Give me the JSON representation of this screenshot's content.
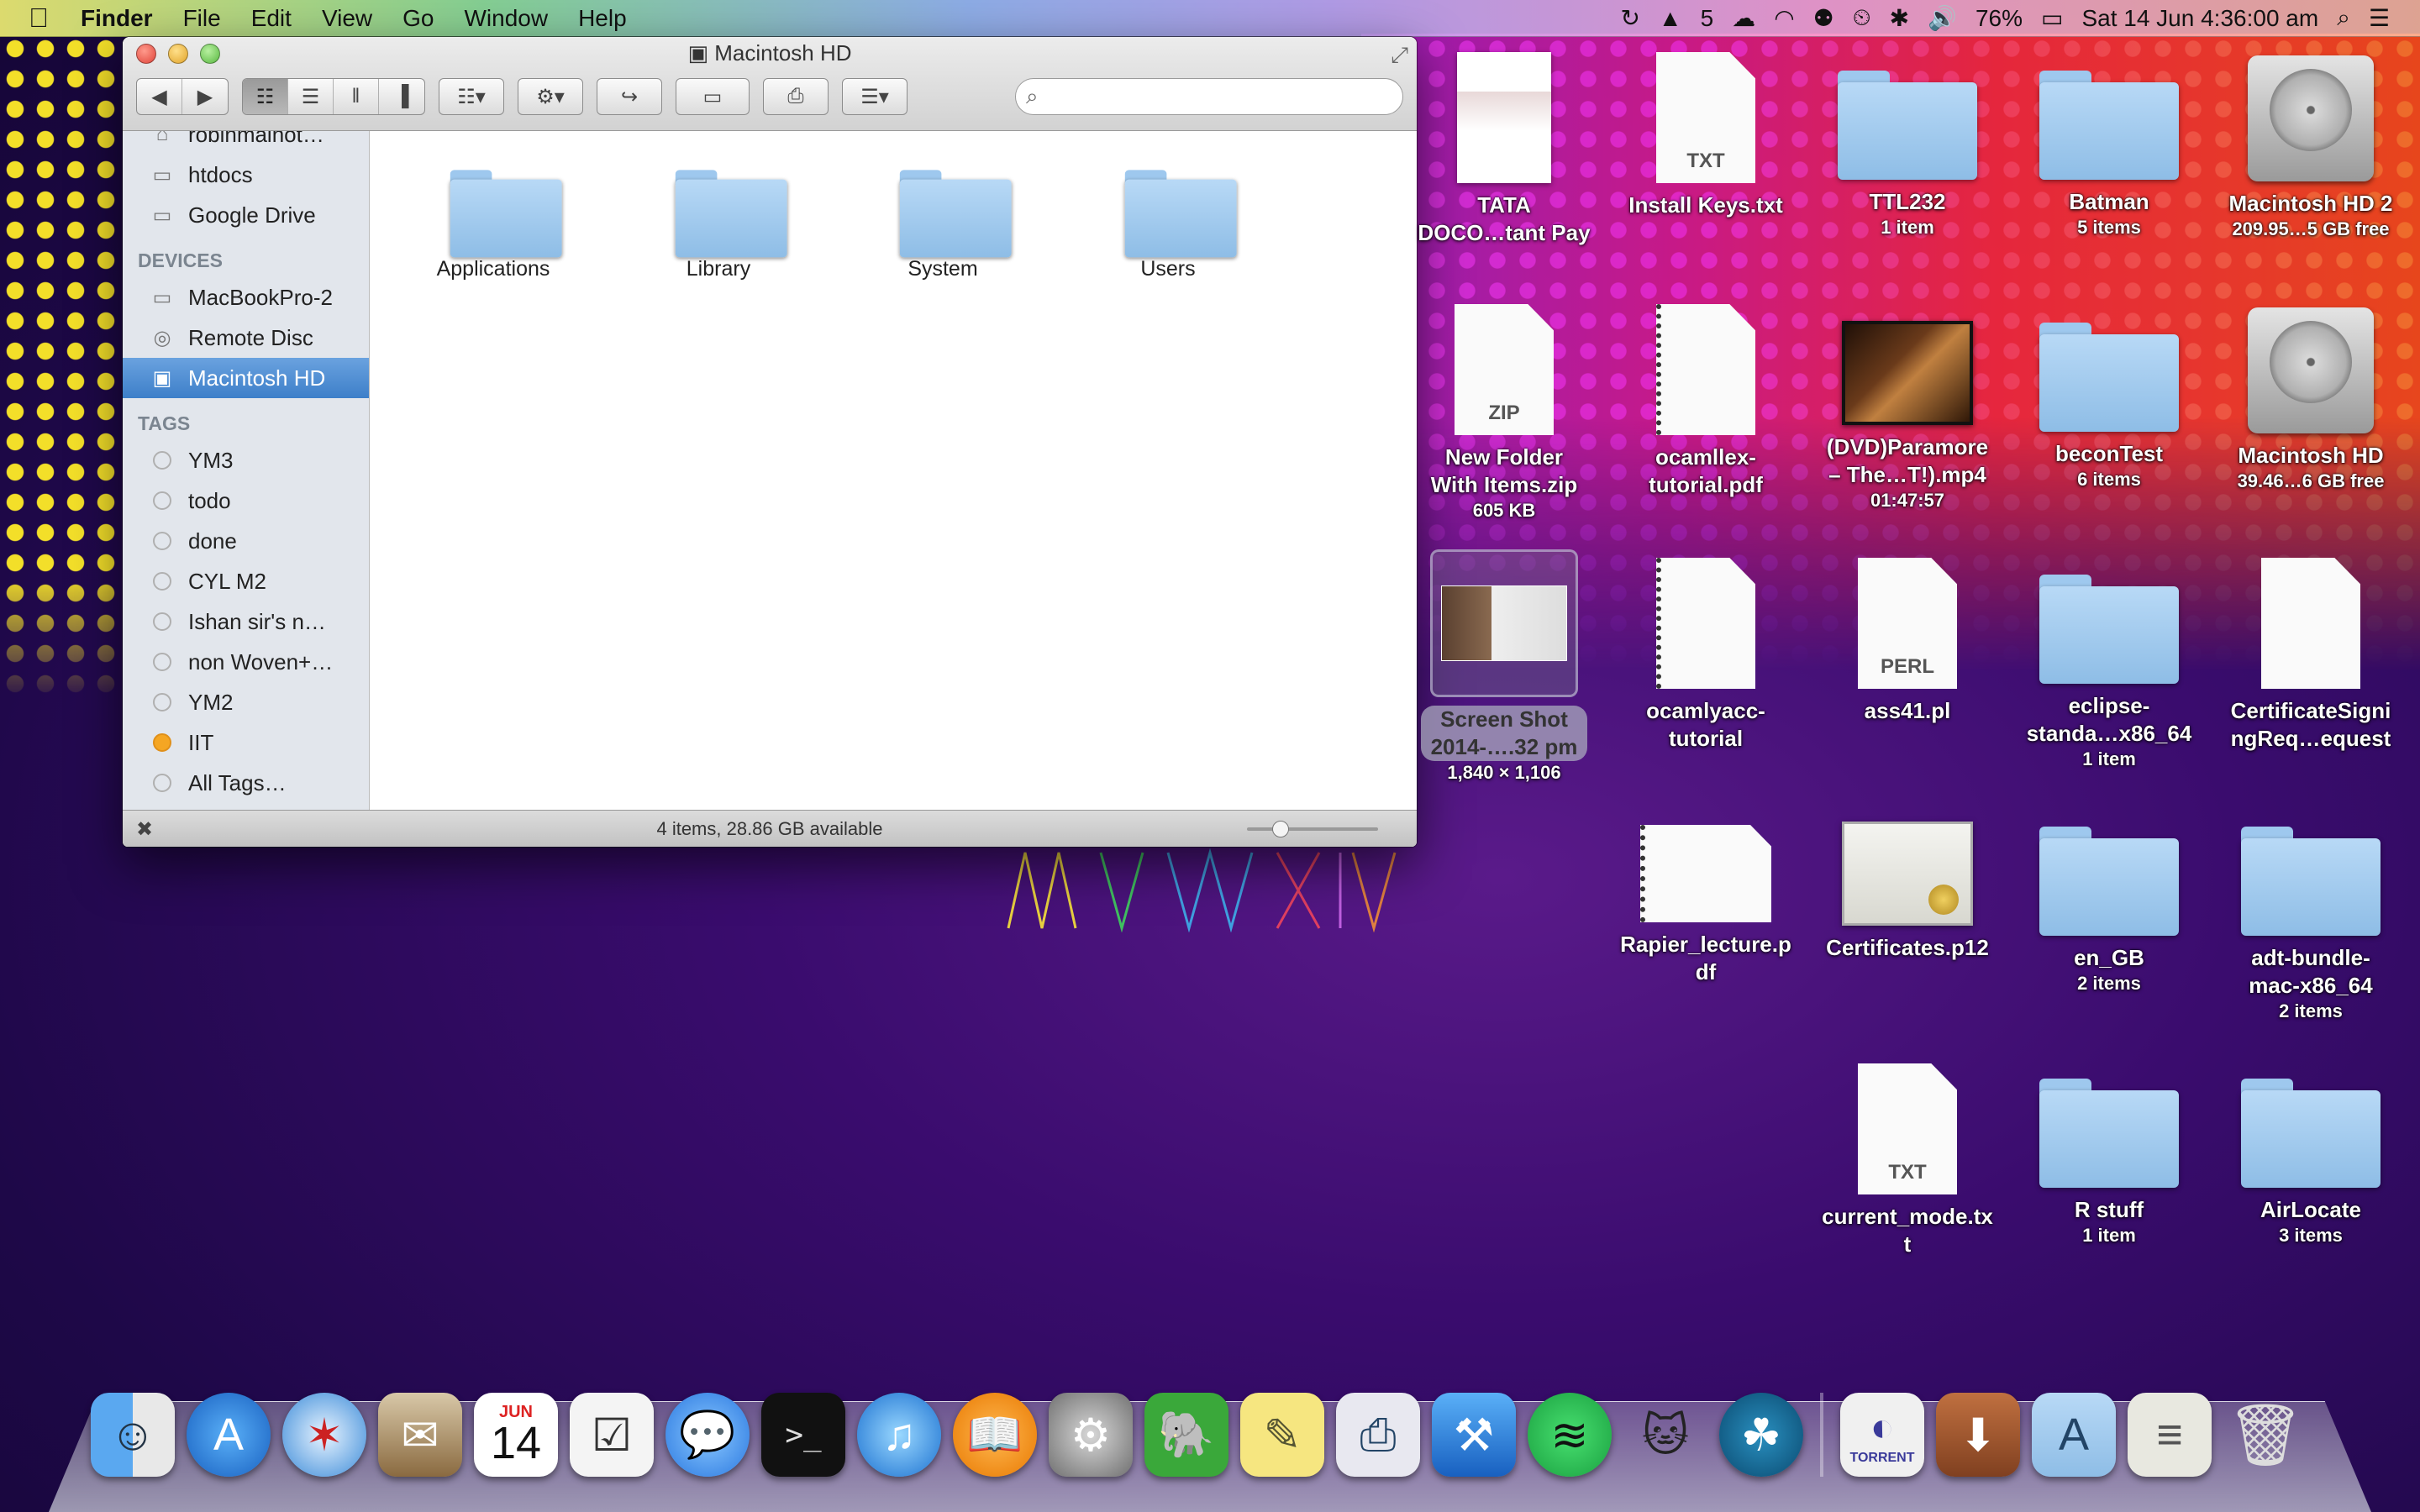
{
  "menubar": {
    "apple": "",
    "app_name": "Finder",
    "menus": [
      "File",
      "Edit",
      "View",
      "Go",
      "Window",
      "Help"
    ],
    "status": {
      "adobe_count": "5",
      "battery": "76%",
      "date_time": "Sat 14 Jun  4:36:00 am"
    }
  },
  "finder": {
    "title": "Macintosh HD",
    "sidebar": {
      "top_items": [
        "robinmainot…",
        "htdocs",
        "Google Drive"
      ],
      "devices_heading": "DEVICES",
      "devices": [
        "MacBookPro-2",
        "Remote Disc",
        "Macintosh HD"
      ],
      "tags_heading": "TAGS",
      "tags": [
        "YM3",
        "todo",
        "done",
        "CYL M2",
        "Ishan sir's n…",
        "non Woven+…",
        "YM2",
        "IIT",
        "All Tags…"
      ]
    },
    "items": [
      "Applications",
      "Library",
      "System",
      "Users"
    ],
    "status_text": "4 items, 28.86 GB available"
  },
  "desktop": {
    "col1": [
      {
        "name": "TATA\nDOCO…tant Pay",
        "sub": ""
      },
      {
        "name": "New Folder\nWith Items.zip",
        "sub": "605 KB"
      },
      {
        "name": "Screen Shot\n2014-….32 pm",
        "sub": "1,840 × 1,106"
      }
    ],
    "col2": [
      {
        "name": "Install Keys.txt",
        "sub": ""
      },
      {
        "name": "ocamllex-\ntutorial.pdf",
        "sub": ""
      },
      {
        "name": "ocamlyacc-\ntutorial",
        "sub": ""
      },
      {
        "name": "Rapier_lecture.p\ndf",
        "sub": ""
      }
    ],
    "col3": [
      {
        "name": "TTL232",
        "sub": "1 item"
      },
      {
        "name": "(DVD)Paramore\n– The…T!).mp4",
        "sub": "01:47:57"
      },
      {
        "name": "ass41.pl",
        "sub": ""
      },
      {
        "name": "Certificates.p12",
        "sub": ""
      },
      {
        "name": "current_mode.tx\nt",
        "sub": ""
      }
    ],
    "col4": [
      {
        "name": "Batman",
        "sub": "5 items"
      },
      {
        "name": "beconTest",
        "sub": "6 items"
      },
      {
        "name": "eclipse-\nstanda…x86_64",
        "sub": "1 item"
      },
      {
        "name": "en_GB",
        "sub": "2 items"
      },
      {
        "name": "R stuff",
        "sub": "1 item"
      }
    ],
    "col5": [
      {
        "name": "Macintosh HD 2",
        "sub": "209.95…5 GB free"
      },
      {
        "name": "Macintosh HD",
        "sub": "39.46…6 GB free"
      },
      {
        "name": "CertificateSigni\nngReq…equest",
        "sub": ""
      },
      {
        "name": "adt-bundle-\nmac-x86_64",
        "sub": "2 items"
      },
      {
        "name": "AirLocate",
        "sub": "3 items"
      }
    ],
    "file_badges": {
      "txt": "TXT",
      "zip": "ZIP",
      "perl": "PERL"
    },
    "wallpaper_text": "MAVX"
  },
  "dock": {
    "calendar_day": "14",
    "calendar_month": "JUN",
    "torrent_label": "TORRENT"
  },
  "colors": {
    "selection": "#3d7fc9",
    "folder": "#9ec8ee",
    "iit_tag": "#f5a623"
  }
}
